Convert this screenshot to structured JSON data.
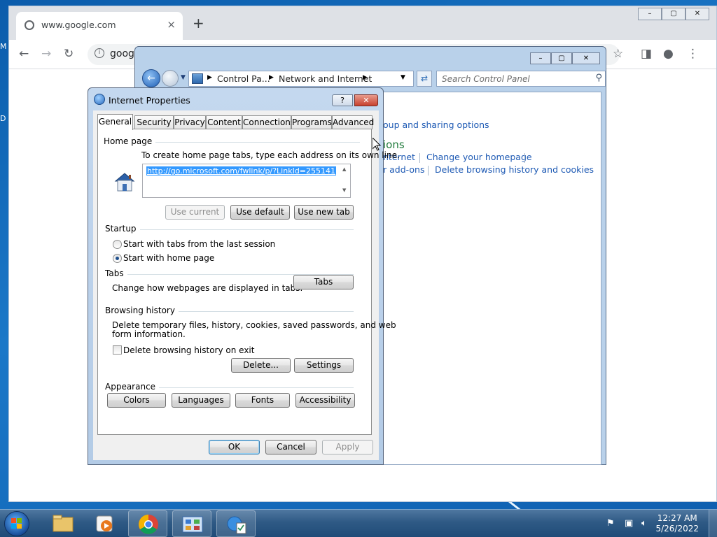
{
  "desktop": {
    "labels": [
      "M",
      "D"
    ]
  },
  "chrome": {
    "tab_title": "www.google.com",
    "tab_close": "×",
    "new_tab": "+",
    "url": "googl",
    "win_min": "–",
    "win_max": "▢",
    "win_close": "✕",
    "back": "←",
    "forward": "→",
    "reload": "↻",
    "star": "☆",
    "sidebar": "◨",
    "profile": "●",
    "menu": "⋮"
  },
  "control_panel": {
    "breadcrumb": [
      "Control Pa...",
      "Network and Internet"
    ],
    "search_placeholder": "Search Control Panel",
    "win_min": "–",
    "win_max": "▢",
    "win_close": "✕",
    "links": {
      "group_sharing": "oup and sharing options",
      "heading": "ions",
      "internet": "nternet",
      "change_homepage": "Change your homepage",
      "addons": "r add-ons",
      "delete_history": "Delete browsing history and cookies"
    }
  },
  "dialog": {
    "title": "Internet Properties",
    "help": "?",
    "close": "✕",
    "tabs": [
      "General",
      "Security",
      "Privacy",
      "Content",
      "Connections",
      "Programs",
      "Advanced"
    ],
    "home_page": {
      "label": "Home page",
      "instruction": "To create home page tabs, type each address on its own line.",
      "url": "http://go.microsoft.com/fwlink/p/?LinkId=255141",
      "use_current": "Use current",
      "use_default": "Use default",
      "use_new_tab": "Use new tab"
    },
    "startup": {
      "label": "Startup",
      "option_last_session": "Start with tabs from the last session",
      "option_home_page": "Start with home page"
    },
    "tabs_group": {
      "label": "Tabs",
      "description": "Change how webpages are displayed in tabs.",
      "button": "Tabs"
    },
    "browsing_history": {
      "label": "Browsing history",
      "description_line1": "Delete temporary files, history, cookies, saved passwords, and web",
      "description_line2": "form information.",
      "delete_on_exit": "Delete browsing history on exit",
      "delete_button": "Delete...",
      "settings_button": "Settings"
    },
    "appearance": {
      "label": "Appearance",
      "colors": "Colors",
      "languages": "Languages",
      "fonts": "Fonts",
      "accessibility": "Accessibility"
    },
    "ok": "OK",
    "cancel": "Cancel",
    "apply": "Apply"
  },
  "taskbar": {
    "time": "12:27 AM",
    "date": "5/26/2022"
  }
}
